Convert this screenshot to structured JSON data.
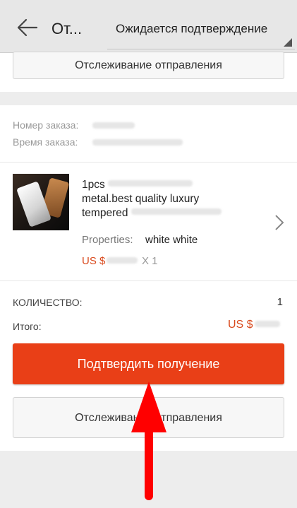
{
  "app_bar": {
    "title": "От...",
    "status_label": "Ожидается подтверждение"
  },
  "tracking_top": {
    "label": "Отслеживание отправления"
  },
  "order_info": {
    "number_label": "Номер заказа:",
    "time_label": "Время заказа:"
  },
  "product": {
    "name_line1": "1pcs ",
    "name_line2": "metal.best quality luxury",
    "name_line3": "tempered ",
    "properties_label": "Properties:",
    "properties_value": "white white",
    "price_prefix": "US $",
    "quantity_mark": "X 1"
  },
  "summary": {
    "quantity_label": "КОЛИЧЕСТВО:",
    "quantity_value": "1",
    "total_label": "Итого:",
    "total_prefix": "US $"
  },
  "actions": {
    "confirm_label": "Подтвердить получение",
    "tracking_label": "Отслеживание отправления"
  },
  "colors": {
    "accent": "#e93f17",
    "price": "#d94a1e",
    "annotation_arrow": "#ff0000"
  },
  "icons": [
    "back-arrow-icon",
    "dropdown-corner-icon",
    "chevron-right-icon",
    "annotation-up-arrow-icon"
  ]
}
